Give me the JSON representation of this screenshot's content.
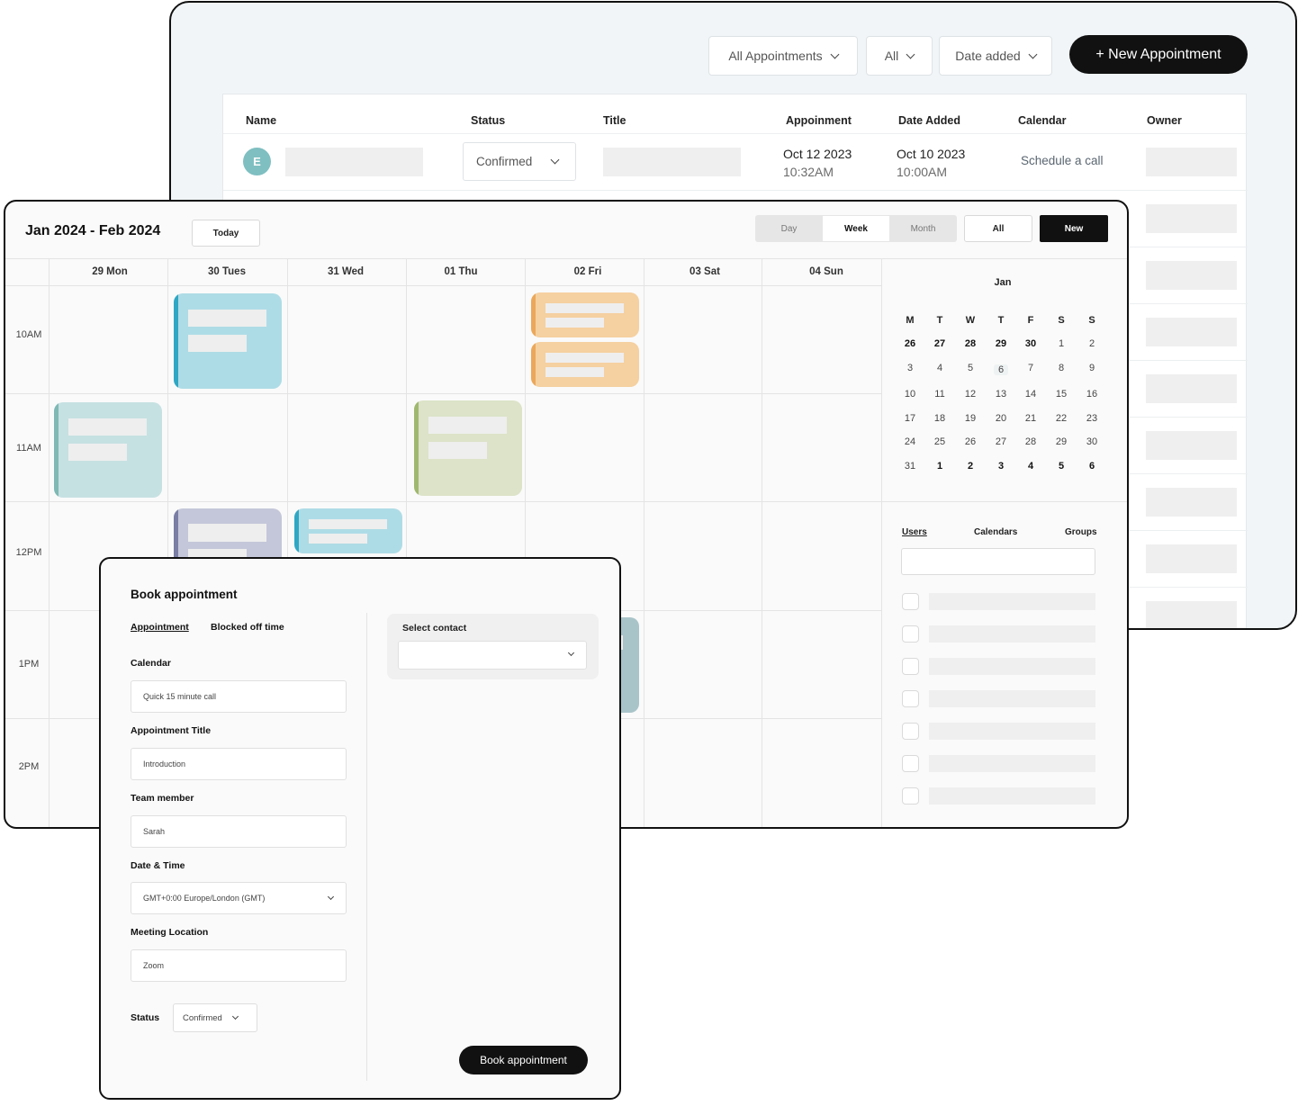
{
  "list": {
    "filters": [
      "All Appointments",
      "All",
      "Date added"
    ],
    "new_button": "+ New Appointment",
    "columns": [
      "Name",
      "Status",
      "Title",
      "Appoinment",
      "Date Added",
      "Calendar",
      "Owner"
    ],
    "row": {
      "avatar": "E",
      "status": "Confirmed",
      "appointment_date": "Oct 12 2023",
      "appointment_time": "10:32AM",
      "added_date": "Oct 10 2023",
      "added_time": "10:00AM",
      "calendar": "Schedule a call"
    }
  },
  "calendar": {
    "range": "Jan 2024 - Feb 2024",
    "today": "Today",
    "views": [
      "Day",
      "Week",
      "Month"
    ],
    "active_view": "Week",
    "all": "All",
    "new": "New",
    "days": [
      "29 Mon",
      "30 Tues",
      "31 Wed",
      "01 Thu",
      "02 Fri",
      "03 Sat",
      "04 Sun"
    ],
    "times": [
      "10AM",
      "11AM",
      "12PM",
      "1PM",
      "2PM"
    ],
    "event_colors": {
      "teal": "#aedce6",
      "teal_bar": "#2fa7c4",
      "orange": "#f5d0a0",
      "orange_bar": "#eba85a",
      "mint": "#c6e1e2",
      "mint_bar": "#7fb8b4",
      "olive": "#dce3c8",
      "olive_bar": "#9fb86f",
      "lavender": "#c4c7d9",
      "lavender_bar": "#7a7ea4",
      "slate": "#a9c4c9"
    },
    "mini": {
      "month": "Jan",
      "weekdays": [
        "M",
        "T",
        "W",
        "T",
        "F",
        "S",
        "S"
      ],
      "weeks": [
        [
          "26",
          "27",
          "28",
          "29",
          "30",
          "1",
          "2"
        ],
        [
          "3",
          "4",
          "5",
          "6",
          "7",
          "8",
          "9"
        ],
        [
          "10",
          "11",
          "12",
          "13",
          "14",
          "15",
          "16"
        ],
        [
          "17",
          "18",
          "19",
          "20",
          "21",
          "22",
          "23"
        ],
        [
          "24",
          "25",
          "26",
          "27",
          "28",
          "29",
          "30"
        ],
        [
          "31",
          "1",
          "2",
          "3",
          "4",
          "5",
          "6"
        ]
      ],
      "selected": "6"
    },
    "side_tabs": [
      "Users",
      "Calendars",
      "Groups"
    ]
  },
  "booking": {
    "title": "Book appointment",
    "tabs": [
      "Appointment",
      "Blocked off time"
    ],
    "fields": [
      {
        "label": "Calendar",
        "value": "Quick 15 minute call"
      },
      {
        "label": "Appointment Title",
        "value": "Introduction"
      },
      {
        "label": "Team member",
        "value": "Sarah"
      },
      {
        "label": "Date & Time",
        "value": "GMT+0:00 Europe/London (GMT)"
      },
      {
        "label": "Meeting Location",
        "value": "Zoom"
      }
    ],
    "status_label": "Status",
    "status_value": "Confirmed",
    "contact_label": "Select contact",
    "submit": "Book appointment"
  }
}
